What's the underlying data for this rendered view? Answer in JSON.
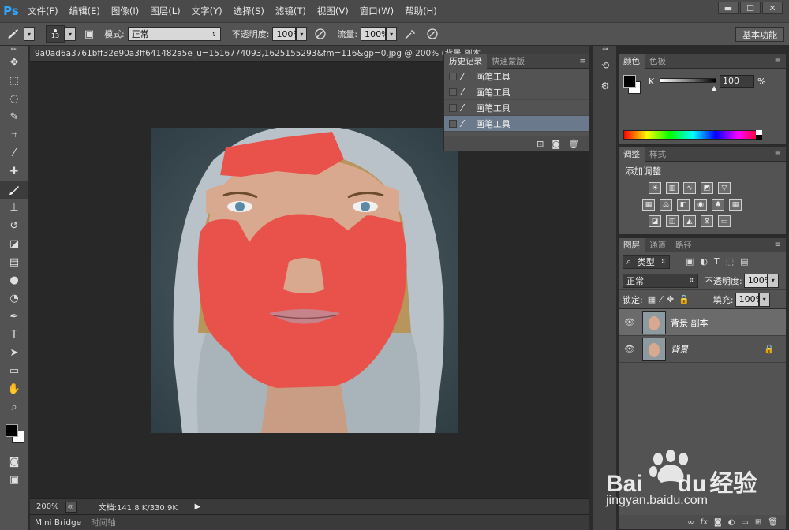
{
  "app": {
    "logo": "Ps"
  },
  "menu": [
    "文件(F)",
    "编辑(E)",
    "图像(I)",
    "图层(L)",
    "文字(Y)",
    "选择(S)",
    "滤镜(T)",
    "视图(V)",
    "窗口(W)",
    "帮助(H)"
  ],
  "window_controls": {
    "minimize": "▬",
    "maximize": "☐",
    "close": "✕"
  },
  "options": {
    "brush_size": "13",
    "mode_label": "模式:",
    "mode_value": "正常",
    "opacity_label": "不透明度:",
    "opacity_value": "100%",
    "flow_label": "流量:",
    "flow_value": "100%",
    "workspace": "基本功能"
  },
  "document": {
    "tab_title": "9a0ad6a3761bff32e90a3ff641482a5e_u=1516774093,1625155293&fm=116&gp=0.jpg @ 200% (背景 副本",
    "zoom": "200%",
    "doc_info": "文档:141.8 K/330.9K"
  },
  "bottom_tabs": [
    "Mini Bridge",
    "时间轴"
  ],
  "history": {
    "tabs": [
      "历史记录",
      "快速蒙版"
    ],
    "items": [
      "画笔工具",
      "画笔工具",
      "画笔工具",
      "画笔工具"
    ],
    "selected_index": 3
  },
  "color_panel": {
    "tabs": [
      "颜色",
      "色板"
    ],
    "channel": "K",
    "value": "100",
    "unit": "%"
  },
  "adjustments_panel": {
    "tabs": [
      "调整",
      "样式"
    ],
    "title": "添加调整"
  },
  "layers_panel": {
    "tabs": [
      "图层",
      "通道",
      "路径"
    ],
    "filter": "类型",
    "blend_mode": "正常",
    "opacity_label": "不透明度:",
    "opacity_value": "100%",
    "lock_label": "锁定:",
    "fill_label": "填充:",
    "fill_value": "100%",
    "layers": [
      {
        "name": "背景 副本",
        "selected": true
      },
      {
        "name": "背景",
        "selected": false,
        "locked": true
      }
    ]
  },
  "watermark": {
    "brand_1": "Bai",
    "brand_2": "du",
    "brand_3": "经验",
    "url": "jingyan.baidu.com"
  },
  "colors": {
    "ui_bg": "#535353",
    "canvas_bg": "#282828",
    "paint_red": "#e8524a",
    "selection": "#6a7a8c"
  }
}
